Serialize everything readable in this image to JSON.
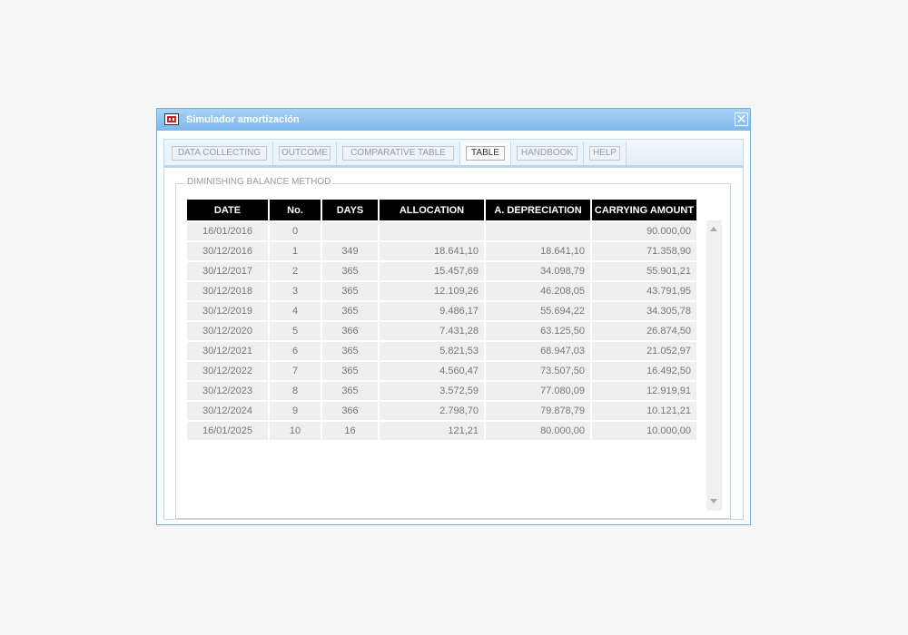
{
  "window": {
    "title": "Simulador amortización",
    "icon": "app-icon",
    "close_icon": "close-icon",
    "close_glyph": "✕"
  },
  "tabs": [
    {
      "label": "DATA COLLECTING",
      "active": false
    },
    {
      "label": "OUTCOME",
      "active": false
    },
    {
      "label": "COMPARATIVE TABLE",
      "active": false
    },
    {
      "label": "TABLE",
      "active": true
    },
    {
      "label": "HANDBOOK",
      "active": false
    },
    {
      "label": "HELP",
      "active": false
    }
  ],
  "section": {
    "legend": "DIMINISHING BALANCE METHOD"
  },
  "table": {
    "headers": [
      "DATE",
      "No.",
      "DAYS",
      "ALLOCATION",
      "A. DEPRECIATION",
      "CARRYING AMOUNT"
    ],
    "rows": [
      [
        "16/01/2016",
        "0",
        "",
        "",
        "",
        "90.000,00"
      ],
      [
        "30/12/2016",
        "1",
        "349",
        "18.641,10",
        "18.641,10",
        "71.358,90"
      ],
      [
        "30/12/2017",
        "2",
        "365",
        "15.457,69",
        "34.098,79",
        "55.901,21"
      ],
      [
        "30/12/2018",
        "3",
        "365",
        "12.109,26",
        "46.208,05",
        "43.791,95"
      ],
      [
        "30/12/2019",
        "4",
        "365",
        "9.486,17",
        "55.694,22",
        "34.305,78"
      ],
      [
        "30/12/2020",
        "5",
        "366",
        "7.431,28",
        "63.125,50",
        "26.874,50"
      ],
      [
        "30/12/2021",
        "6",
        "365",
        "5.821,53",
        "68.947,03",
        "21.052,97"
      ],
      [
        "30/12/2022",
        "7",
        "365",
        "4.560,47",
        "73.507,50",
        "16.492,50"
      ],
      [
        "30/12/2023",
        "8",
        "365",
        "3.572,59",
        "77.080,09",
        "12.919,91"
      ],
      [
        "30/12/2024",
        "9",
        "366",
        "2.798,70",
        "79.878,79",
        "10.121,21"
      ],
      [
        "16/01/2025",
        "10",
        "16",
        "121,21",
        "80.000,00",
        "10.000,00"
      ]
    ]
  },
  "scrollbar": {
    "up_icon": "scroll-up-arrow-icon",
    "down_icon": "scroll-down-arrow-icon"
  },
  "colors": {
    "titlebar": "#7db7ec",
    "header_bg": "#000000",
    "cell_bg": "#efefef"
  }
}
